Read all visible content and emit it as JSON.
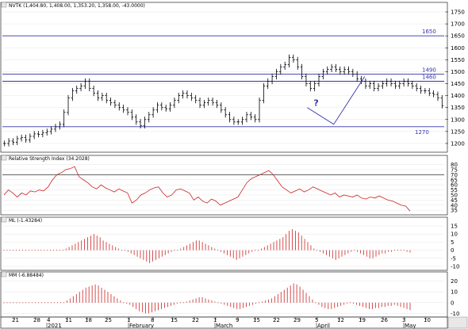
{
  "colors": {
    "price_bars": "#000000",
    "rsi_line": "#cc2222",
    "osc_bars": "#cc2222",
    "level_lines": "#3333aa",
    "annotation": "#3333aa",
    "grid": "#dddddd"
  },
  "icons": {
    "panel_icon": "panel-options-icon",
    "scroll": "scroll-corner-icon"
  },
  "chart_data": [
    {
      "type": "ohlc",
      "title": "NVTK (1,404.80, 1,408.00, 1,353.20, 1,358.00, -43.0000)",
      "ylim": [
        1170,
        1760
      ],
      "yticks": [
        1200,
        1250,
        1300,
        1350,
        1400,
        1450,
        1500,
        1550,
        1600,
        1650,
        1700,
        1750
      ],
      "hlines": [
        1650,
        1490,
        1460,
        1270
      ],
      "hline_labels": [
        "1650",
        "1490",
        "1460",
        "1270"
      ],
      "annotation": {
        "label": "?",
        "projection_path": [
          [
            1350,
            69
          ],
          [
            1280,
            75
          ],
          [
            1480,
            82
          ]
        ]
      },
      "values": [
        1200,
        1210,
        1205,
        1220,
        1225,
        1215,
        1230,
        1240,
        1238,
        1245,
        1250,
        1260,
        1270,
        1280,
        1330,
        1390,
        1420,
        1430,
        1440,
        1460,
        1430,
        1410,
        1390,
        1400,
        1380,
        1370,
        1360,
        1350,
        1340,
        1330,
        1310,
        1290,
        1275,
        1300,
        1320,
        1340,
        1360,
        1350,
        1345,
        1360,
        1380,
        1400,
        1410,
        1400,
        1390,
        1380,
        1360,
        1370,
        1380,
        1370,
        1360,
        1340,
        1320,
        1300,
        1290,
        1290,
        1300,
        1320,
        1310,
        1300,
        1380,
        1440,
        1460,
        1480,
        1500,
        1520,
        1530,
        1560,
        1550,
        1520,
        1480,
        1450,
        1430,
        1450,
        1480,
        1500,
        1510,
        1520,
        1510,
        1500,
        1510,
        1500,
        1490,
        1470,
        1460,
        1440,
        1450,
        1430,
        1440,
        1450,
        1460,
        1450,
        1440,
        1450,
        1460,
        1450,
        1440,
        1430,
        1420,
        1420,
        1410,
        1405,
        1390,
        1358
      ]
    },
    {
      "type": "line",
      "title": "Relative Strength Index (34.2028)",
      "ylim": [
        32,
        82
      ],
      "yticks": [
        35,
        40,
        45,
        50,
        55,
        60,
        65,
        70,
        75,
        80
      ],
      "hlines": [
        70,
        30
      ],
      "values": [
        50,
        55,
        52,
        48,
        52,
        50,
        54,
        53,
        55,
        54,
        58,
        65,
        70,
        72,
        75,
        76,
        78,
        68,
        65,
        62,
        58,
        56,
        60,
        57,
        55,
        53,
        56,
        54,
        52,
        42,
        45,
        50,
        52,
        55,
        57,
        58,
        52,
        48,
        50,
        55,
        56,
        54,
        52,
        45,
        48,
        44,
        42,
        46,
        44,
        40,
        42,
        44,
        46,
        48,
        55,
        62,
        66,
        68,
        70,
        72,
        74,
        70,
        64,
        58,
        55,
        52,
        54,
        56,
        53,
        55,
        58,
        56,
        54,
        52,
        50,
        52,
        48,
        50,
        49,
        48,
        50,
        47,
        46,
        48,
        47,
        49,
        47,
        45,
        44,
        42,
        40,
        39,
        34.2
      ]
    },
    {
      "type": "bar",
      "title": "ML (-1.43284)",
      "ylim": [
        -11,
        16
      ],
      "yticks": [
        -10,
        -5,
        0,
        5,
        10,
        15
      ],
      "values": [
        0,
        0,
        0,
        0,
        0,
        0,
        0,
        0,
        0,
        0,
        0,
        0,
        0,
        0,
        0,
        0,
        0,
        0,
        0,
        0,
        1,
        2,
        3,
        4,
        5,
        6,
        7,
        8,
        9,
        10,
        9,
        8,
        6,
        5,
        4,
        3,
        2,
        1,
        0,
        0,
        -1,
        -2,
        -3,
        -4,
        -5,
        -6,
        -7,
        -8,
        -7,
        -6,
        -5,
        -4,
        -3,
        -2,
        -1,
        0,
        0,
        1,
        2,
        3,
        4,
        5,
        6,
        6,
        5,
        4,
        3,
        2,
        1,
        0,
        -1,
        -2,
        -3,
        -4,
        -5,
        -6,
        -5,
        -4,
        -3,
        -2,
        -1,
        0,
        0,
        1,
        2,
        3,
        4,
        5,
        6,
        7,
        8,
        10,
        12,
        13,
        12,
        11,
        9,
        7,
        5,
        3,
        1,
        0,
        -1,
        -2,
        -3,
        -4,
        -5,
        -6,
        -5,
        -4,
        -3,
        -2,
        -1,
        0,
        -1,
        -2,
        -3,
        -4,
        -5,
        -5,
        -4,
        -3,
        -2,
        -2,
        -1,
        -1,
        0,
        0,
        0,
        0,
        -1,
        -1.4
      ]
    },
    {
      "type": "bar",
      "title": "MM (-6.88484)",
      "ylim": [
        -12,
        22
      ],
      "yticks": [
        -10,
        0,
        10,
        20
      ],
      "values": [
        0,
        0,
        0,
        0,
        0,
        0,
        0,
        0,
        0,
        0,
        0,
        0,
        0,
        0,
        0,
        0,
        0,
        0,
        0,
        0,
        2,
        4,
        6,
        8,
        10,
        12,
        14,
        15,
        16,
        17,
        16,
        14,
        12,
        10,
        8,
        6,
        4,
        2,
        0,
        -1,
        -2,
        -4,
        -6,
        -8,
        -9,
        -10,
        -10,
        -9,
        -8,
        -7,
        -6,
        -5,
        -4,
        -3,
        -2,
        -1,
        0,
        0,
        1,
        2,
        3,
        4,
        5,
        5,
        4,
        3,
        2,
        1,
        0,
        -1,
        -2,
        -3,
        -4,
        -5,
        -6,
        -6,
        -5,
        -4,
        -3,
        -2,
        -1,
        0,
        1,
        2,
        3,
        4,
        6,
        8,
        10,
        12,
        14,
        16,
        18,
        17,
        15,
        12,
        9,
        6,
        3,
        0,
        -2,
        -4,
        -5,
        -6,
        -6,
        -5,
        -4,
        -3,
        -2,
        -1,
        0,
        -1,
        -2,
        -3,
        -4,
        -5,
        -6,
        -6,
        -5,
        -5,
        -4,
        -4,
        -3,
        -3,
        -2,
        -3,
        -4,
        -5,
        -6,
        -6.9
      ]
    }
  ],
  "x_axis": {
    "day_ticks": [
      "21",
      "28",
      "4",
      "11",
      "18",
      "25",
      "1",
      "8",
      "15",
      "22",
      "1",
      "9",
      "15",
      "22",
      "29",
      "5",
      "12",
      "19",
      "26",
      "3",
      "10",
      "17"
    ],
    "month_labels": [
      "2021",
      "February",
      "March",
      "April",
      "May"
    ]
  }
}
